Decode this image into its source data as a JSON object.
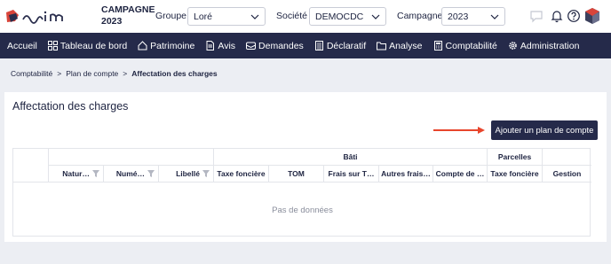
{
  "header": {
    "campaign_title_line1": "CAMPAGNE",
    "campaign_title_line2": "2023",
    "groupe_label": "Groupe :",
    "groupe_value": "Loré",
    "societe_label": "Société :",
    "societe_value": "DEMOCDC",
    "campagne_label": "Campagne :",
    "campagne_value": "2023"
  },
  "nav": {
    "items": [
      {
        "label": "Accueil",
        "icon": "none"
      },
      {
        "label": "Tableau de bord",
        "icon": "dashboard-icon"
      },
      {
        "label": "Patrimoine",
        "icon": "home-icon"
      },
      {
        "label": "Avis",
        "icon": "document-icon"
      },
      {
        "label": "Demandes",
        "icon": "mail-icon"
      },
      {
        "label": "Déclaratif",
        "icon": "form-icon"
      },
      {
        "label": "Analyse",
        "icon": "folder-icon"
      },
      {
        "label": "Comptabilité",
        "icon": "calculator-icon"
      },
      {
        "label": "Administration",
        "icon": "gear-icon"
      }
    ]
  },
  "breadcrumb": {
    "item1": "Comptabilité",
    "item2": "Plan de compte",
    "current": "Affectation des charges",
    "separator": ">"
  },
  "page": {
    "title": "Affectation des charges",
    "add_button": "Ajouter un plan de compte"
  },
  "table": {
    "group_bati": "Bâti",
    "group_parcelles": "Parcelles",
    "columns": {
      "nature": "Natur…",
      "numero": "Numé…",
      "libelle": "Libellé",
      "taxe_fonciere": "Taxe foncière",
      "tom": "TOM",
      "frais": "Frais sur T…",
      "autres_frais": "Autres frais…",
      "compte": "Compte de …",
      "taxe_fonciere_parcelles": "Taxe foncière",
      "gestion": "Gestion"
    },
    "empty_text": "Pas de données"
  },
  "colors": {
    "nav_bg": "#252a4a",
    "accent_arrow": "#e8452c",
    "page_bg": "#eceef3"
  }
}
